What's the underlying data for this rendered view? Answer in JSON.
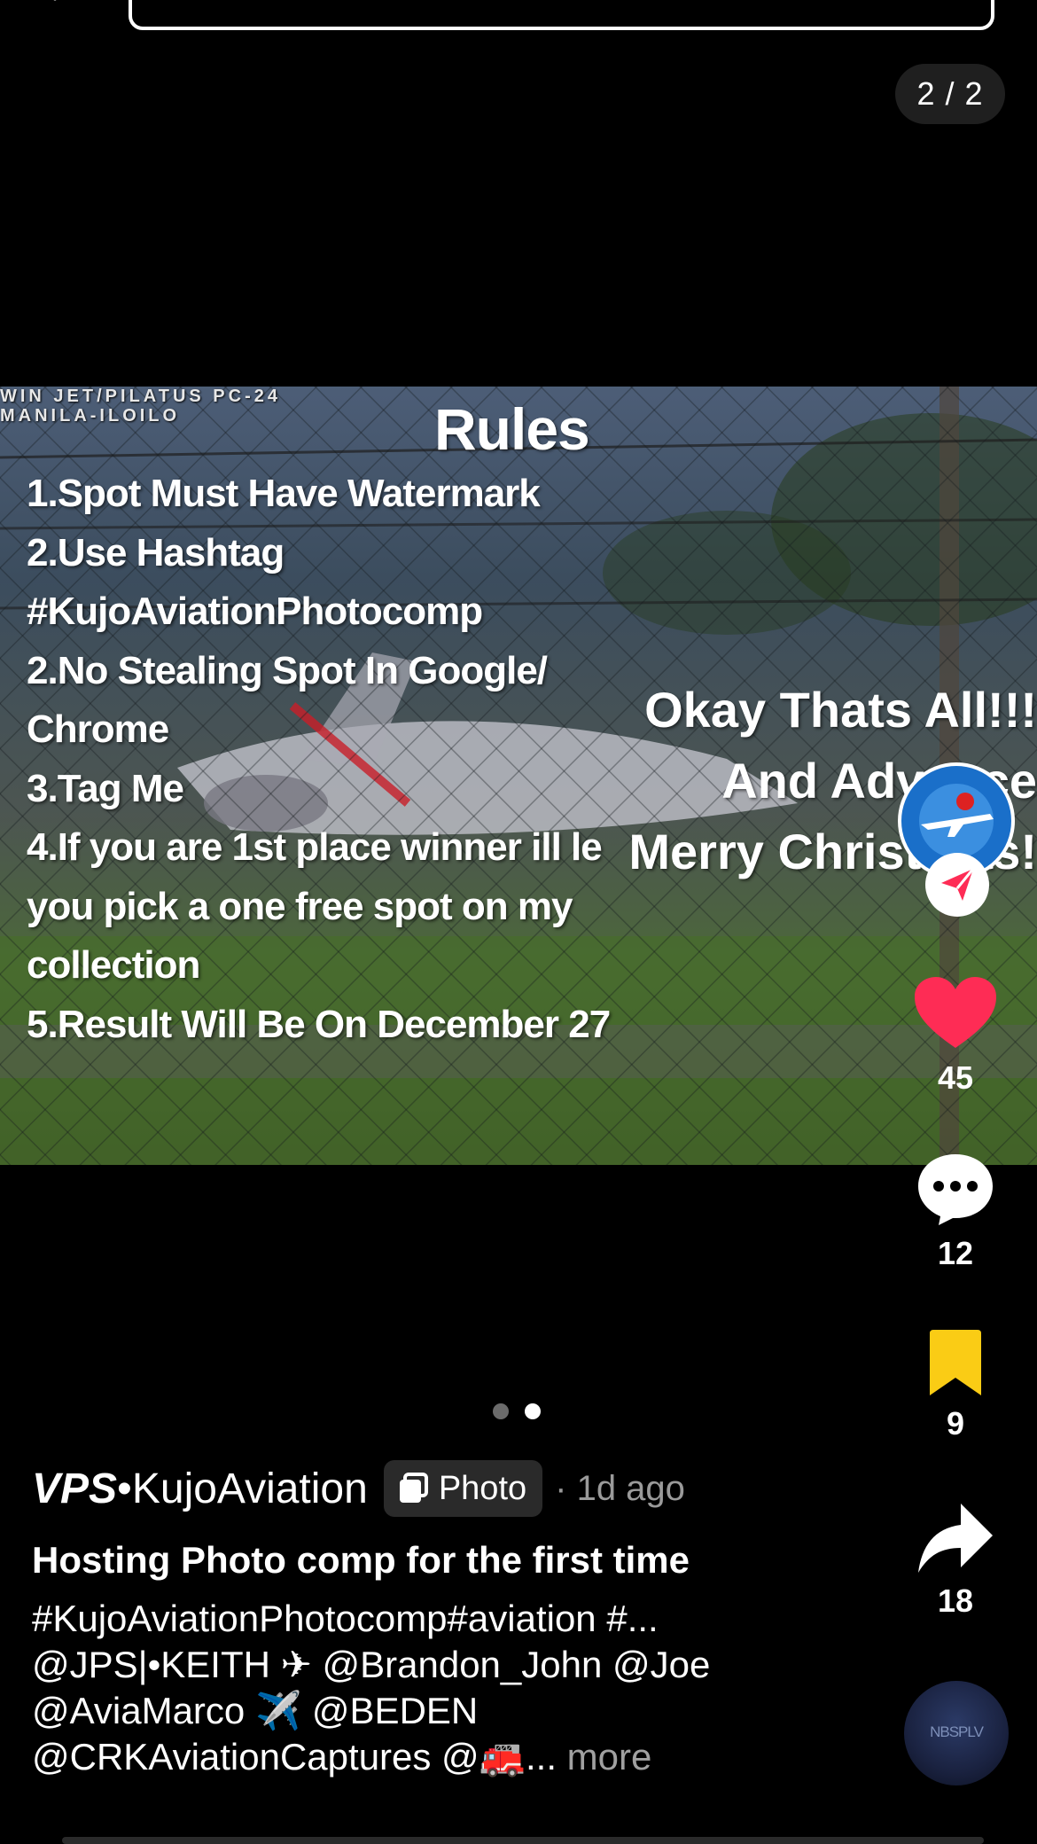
{
  "search": {
    "placeholder": ""
  },
  "counter": "2 / 2",
  "photo": {
    "corner_caption_line1": "WIN JET/PILATUS PC-24",
    "corner_caption_line2": "MANILA-ILOILO",
    "title": "Rules",
    "rules": [
      "1.Spot Must Have Watermark",
      "2.Use Hashtag",
      "#KujoAviationPhotocomp",
      "2.No Stealing Spot In Google/",
      "Chrome",
      "3.Tag Me",
      "4.If you are 1st place winner ill le",
      "you pick a one free spot on my",
      "collection",
      "5.Result Will Be On December 27"
    ],
    "closing": [
      "Okay Thats All!!!",
      "And Advance",
      "Merry Christmas!"
    ]
  },
  "actions": {
    "likes": "45",
    "comments": "12",
    "saves": "9",
    "shares": "18"
  },
  "colors": {
    "like": "#fe2c55",
    "save": "#facc15",
    "badge": "#1a6fc9"
  },
  "carousel": {
    "count": 2,
    "active": 2
  },
  "post": {
    "author_prefix": "VPS",
    "author_name": "•KujoAviation",
    "type_tag": "Photo",
    "time_ago": "· 1d ago",
    "title": "Hosting Photo comp for the first time",
    "line1": "#KujoAviationPhotocomp#aviation #...",
    "line2": "@JPS|•KEITH ✈ @Brandon_John @Joe",
    "line3": "@AviaMarco ✈️ @BEDEN",
    "line4": "@CRKAviationCaptures @🚒...",
    "more": "more"
  },
  "music": {
    "label": "NBSPLV"
  },
  "icons": [
    "back-icon",
    "search-icon",
    "heart-icon",
    "comment-icon",
    "bookmark-icon",
    "share-icon",
    "photo-icon",
    "follow-icon"
  ]
}
